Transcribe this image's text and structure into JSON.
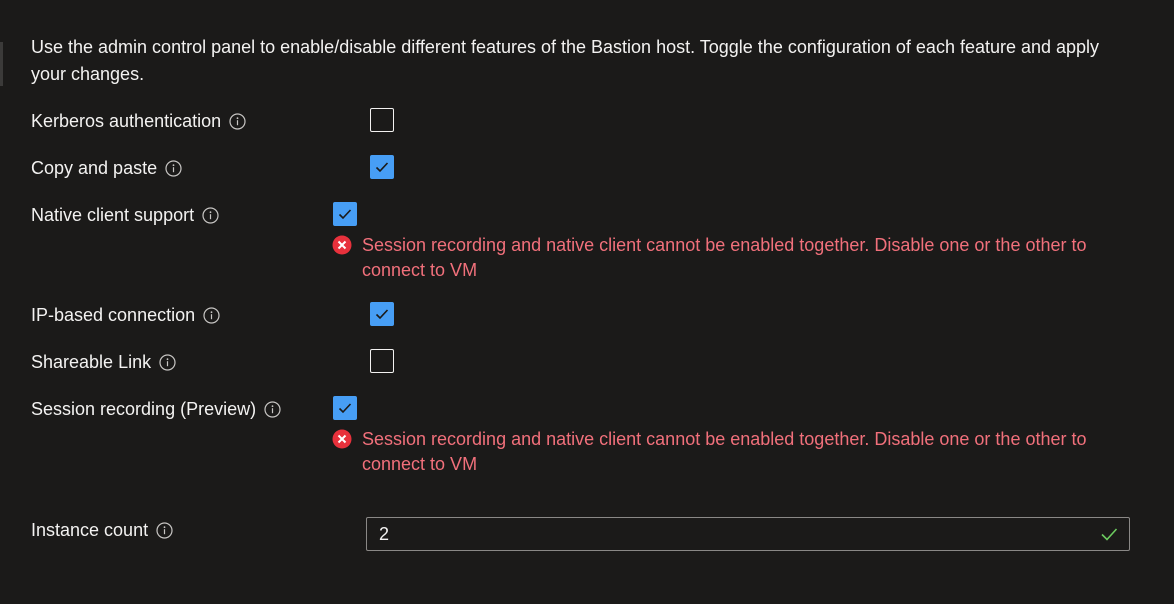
{
  "intro": {
    "text": "Use the admin control panel to enable/disable different features of the Bastion host. Toggle the configuration of each feature and apply your changes."
  },
  "features": [
    {
      "label": "Kerberos authentication",
      "checked": false
    },
    {
      "label": "Copy and paste",
      "checked": true
    },
    {
      "label": "Native client support",
      "checked": true,
      "error": "Session recording and native client cannot be enabled together. Disable one or the other to connect to VM"
    },
    {
      "label": "IP-based connection",
      "checked": true
    },
    {
      "label": "Shareable Link",
      "checked": false
    },
    {
      "label": "Session recording (Preview)",
      "checked": true,
      "error": "Session recording and native client cannot be enabled together. Disable one or the other to connect to VM"
    }
  ],
  "instance_count": {
    "label": "Instance count",
    "value": "2"
  },
  "colors": {
    "background": "#1b1a19",
    "checkbox_checked": "#479ef5",
    "error_text": "#f1707b",
    "error_icon": "#e8313c",
    "valid_check": "#6ccb5f"
  },
  "icons": {
    "info": "info-icon",
    "error": "error-circle-icon",
    "checkmark": "checkmark-icon",
    "valid": "valid-check-icon"
  }
}
